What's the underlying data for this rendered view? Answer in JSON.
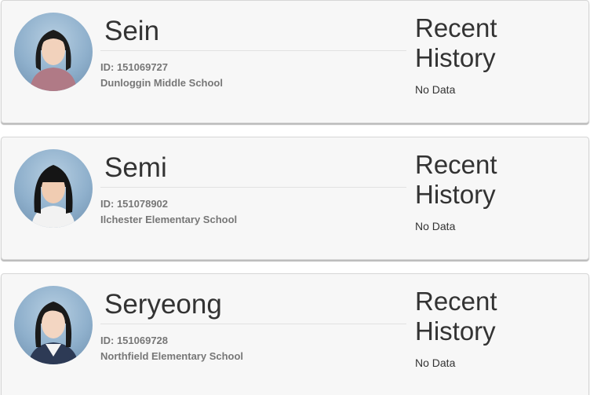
{
  "students": [
    {
      "name": "Sein",
      "id_text": "ID: 151069727",
      "school": "Dunloggin Middle School",
      "history_title": "Recent History",
      "history_status": "No Data",
      "shirt_color": "#b07a86"
    },
    {
      "name": "Semi",
      "id_text": "ID: 151078902",
      "school": "Ilchester Elementary School",
      "history_title": "Recent History",
      "history_status": "No Data",
      "shirt_color": "#f2f2f2"
    },
    {
      "name": "Seryeong",
      "id_text": "ID: 151069728",
      "school": "Northfield Elementary School",
      "history_title": "Recent History",
      "history_status": "No Data",
      "shirt_color": "#2d3a55"
    }
  ]
}
